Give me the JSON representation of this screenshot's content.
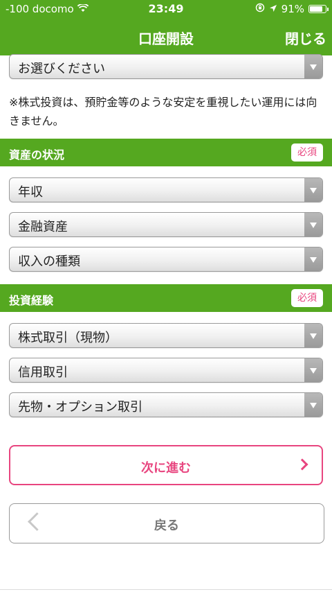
{
  "status_bar": {
    "carrier": "-100 docomo",
    "time": "23:49",
    "battery": "91%",
    "battery_level": 0.91
  },
  "nav": {
    "title": "口座開設",
    "close_label": "閉じる"
  },
  "top_select": {
    "label": "お選びください"
  },
  "note": "※株式投資は、預貯金等のような安定を重視したい運用には向きません。",
  "assets_section": {
    "title": "資産の状況",
    "badge": "必須",
    "selects": [
      "年収",
      "金融資産",
      "収入の種類"
    ]
  },
  "experience_section": {
    "title": "投資経験",
    "badge": "必須",
    "selects": [
      "株式取引（現物）",
      "信用取引",
      "先物・オプション取引"
    ]
  },
  "buttons": {
    "next": "次に進む",
    "back": "戻る"
  },
  "colors": {
    "header_green": "#55a820",
    "accent_pink": "#e8457f"
  }
}
